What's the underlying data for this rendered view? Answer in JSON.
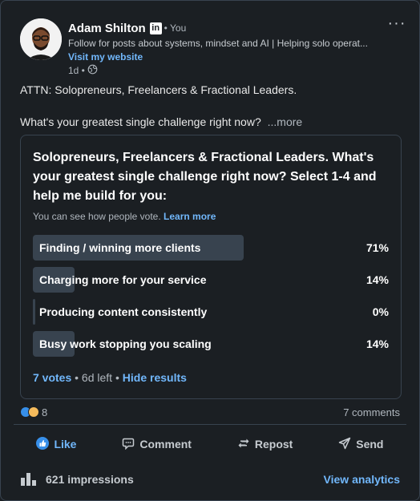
{
  "post": {
    "author": {
      "name": "Adam Shilton",
      "badge": "in",
      "degree": "• You",
      "headline": "Follow for posts about systems, mindset and AI | Helping solo operat...",
      "website_label": "Visit my website",
      "time": "1d •"
    },
    "more_icon": "more-horizontal-icon",
    "text_line1": "ATTN: Solopreneurs, Freelancers & Fractional Leaders.",
    "text_line2": "What's your greatest single challenge right now?",
    "more_label": "...more"
  },
  "poll": {
    "question": "Solopreneurs, Freelancers & Fractional Leaders. What's your greatest single challenge right now? Select 1-4 and help me build for you:",
    "note": "You can see how people vote.",
    "learn_more": "Learn more",
    "options": [
      {
        "label": "Finding / winning more clients",
        "pct": "71%",
        "value": 71
      },
      {
        "label": "Charging more for your service",
        "pct": "14%",
        "value": 14
      },
      {
        "label": "Producing content consistently",
        "pct": "0%",
        "value": 0
      },
      {
        "label": "Busy work stopping you scaling",
        "pct": "14%",
        "value": 14
      }
    ],
    "votes": "7 votes",
    "time_left": "• 6d left •",
    "hide_results": "Hide results"
  },
  "social": {
    "reaction_count": "8",
    "comments": "7 comments"
  },
  "actions": {
    "like": "Like",
    "comment": "Comment",
    "repost": "Repost",
    "send": "Send"
  },
  "analytics": {
    "impressions": "621 impressions",
    "view_analytics": "View analytics"
  },
  "colors": {
    "background": "#1b1f23",
    "border": "#38434f",
    "link": "#71b7fb",
    "poll_bar": "#38434f"
  }
}
